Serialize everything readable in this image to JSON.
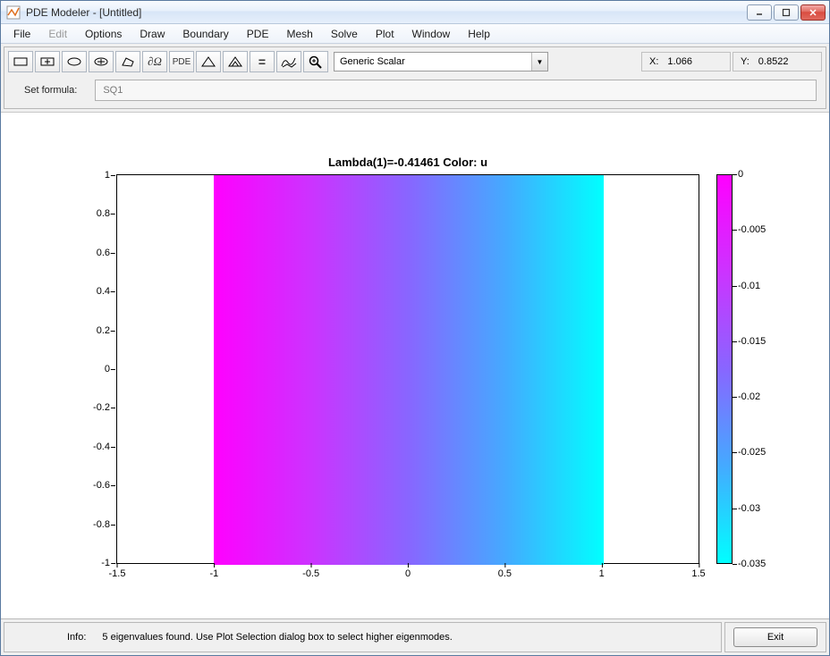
{
  "titlebar": {
    "title": "PDE Modeler - [Untitled]"
  },
  "menu": {
    "items": [
      "File",
      "Edit",
      "Options",
      "Draw",
      "Boundary",
      "PDE",
      "Mesh",
      "Solve",
      "Plot",
      "Window",
      "Help"
    ],
    "disabled": [
      "Edit"
    ]
  },
  "toolbar": {
    "buttons": [
      {
        "name": "rect-icon"
      },
      {
        "name": "rect-center-icon"
      },
      {
        "name": "ellipse-icon"
      },
      {
        "name": "ellipse-center-icon"
      },
      {
        "name": "polygon-icon"
      },
      {
        "name": "boundary-icon",
        "text": "∂Ω"
      },
      {
        "name": "pde-icon",
        "text": "PDE"
      },
      {
        "name": "mesh-icon"
      },
      {
        "name": "refine-mesh-icon"
      },
      {
        "name": "solve-icon",
        "text": "="
      },
      {
        "name": "plot3d-icon"
      },
      {
        "name": "zoom-icon"
      }
    ],
    "app_select": "Generic Scalar",
    "coords": {
      "x_label": "X:",
      "x_value": "1.066",
      "y_label": "Y:",
      "y_value": "0.8522"
    }
  },
  "formula": {
    "label": "Set formula:",
    "value": "SQ1"
  },
  "info": {
    "label": "Info:",
    "text": "5 eigenvalues found. Use Plot Selection dialog box to select higher eigenmodes."
  },
  "exit": {
    "label": "Exit"
  },
  "chart_data": {
    "type": "heatmap",
    "title": "Lambda(1)=-0.41461   Color: u",
    "xlabel": "",
    "ylabel": "",
    "xlim": [
      -1.5,
      1.5
    ],
    "ylim": [
      -1,
      1
    ],
    "xticks": [
      -1.5,
      -1,
      -0.5,
      0,
      0.5,
      1,
      1.5
    ],
    "yticks": [
      -1,
      -0.8,
      -0.6,
      -0.4,
      -0.2,
      0,
      0.2,
      0.4,
      0.6,
      0.8,
      1
    ],
    "data_extent": {
      "xmin": -1,
      "xmax": 1,
      "ymin": -1,
      "ymax": 1
    },
    "color_variable": "u",
    "colorbar": {
      "min": -0.035,
      "max": 0,
      "ticks": [
        0,
        -0.005,
        -0.01,
        -0.015,
        -0.02,
        -0.025,
        -0.03,
        -0.035
      ],
      "colormap": "cool"
    }
  }
}
